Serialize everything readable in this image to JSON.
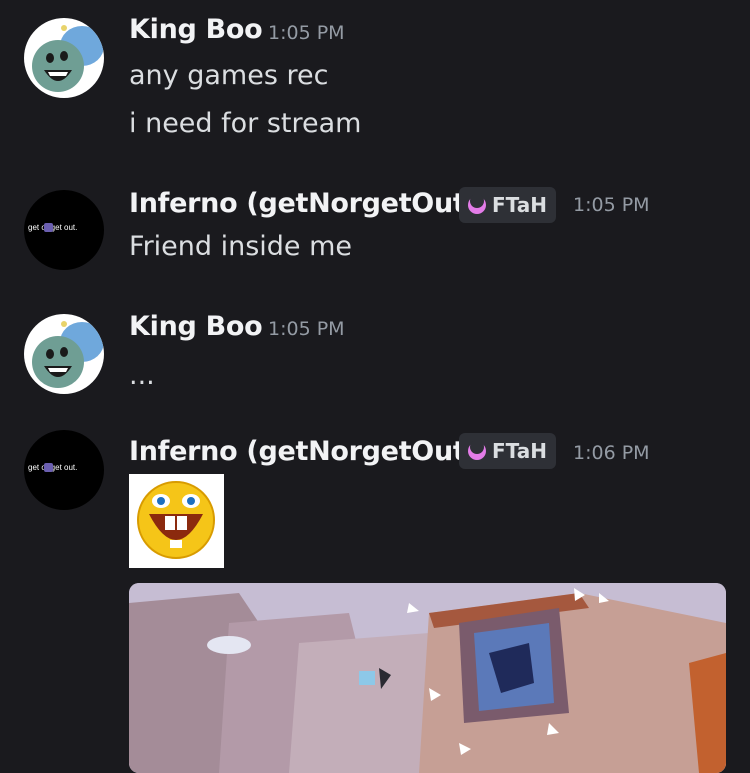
{
  "messages": [
    {
      "author": "King Boo",
      "time": "1:05 PM",
      "lines": [
        "any games rec",
        "i need for stream"
      ]
    },
    {
      "author": "Inferno (getNorgetOut)",
      "tag": "FTaH",
      "time": "1:05 PM",
      "lines": [
        "Friend inside me"
      ],
      "avatar_text": "get  or get out."
    },
    {
      "author": "King Boo",
      "time": "1:05 PM",
      "lines": [
        "..."
      ]
    },
    {
      "author": "Inferno (getNorgetOut)",
      "tag": "FTaH",
      "time": "1:06 PM",
      "lines": [],
      "avatar_text": "get  or get out."
    }
  ],
  "colors": {
    "background": "#1a1a1e",
    "tag_icon": "#e37ce8",
    "username": "#f2f3f5",
    "timestamp": "#949ba4"
  }
}
